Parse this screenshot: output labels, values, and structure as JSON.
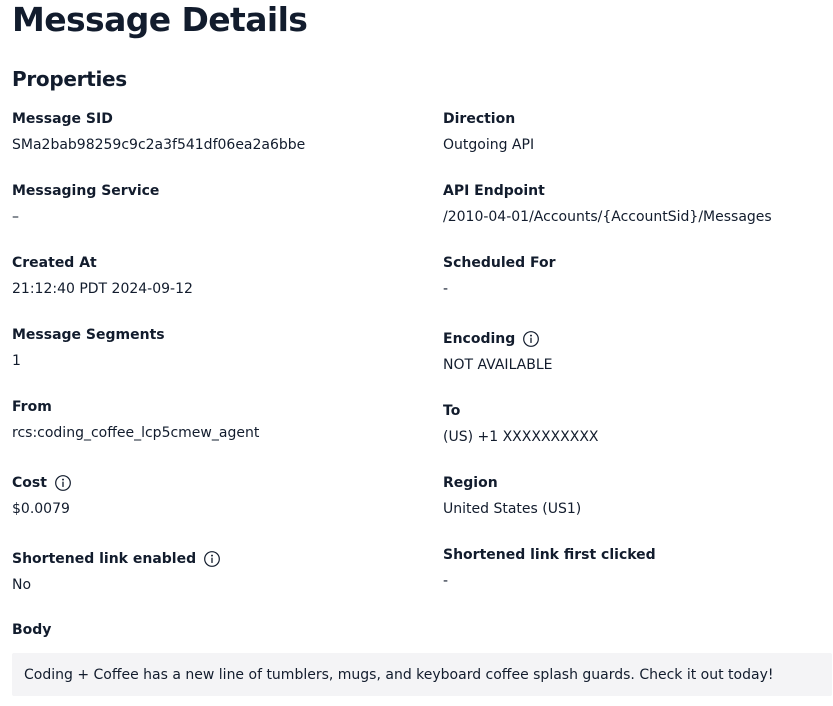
{
  "page": {
    "title": "Message Details",
    "section_title": "Properties"
  },
  "fields": {
    "message_sid": {
      "label": "Message SID",
      "value": "SMa2bab98259c9c2a3f541df06ea2a6bbe"
    },
    "direction": {
      "label": "Direction",
      "value": "Outgoing API"
    },
    "messaging_service": {
      "label": "Messaging Service",
      "value": "–"
    },
    "api_endpoint": {
      "label": "API Endpoint",
      "value": "/2010-04-01/Accounts/{AccountSid}/Messages"
    },
    "created_at": {
      "label": "Created At",
      "value": "21:12:40 PDT 2024-09-12"
    },
    "scheduled_for": {
      "label": "Scheduled For",
      "value": "-"
    },
    "message_segments": {
      "label": "Message Segments",
      "value": "1"
    },
    "encoding": {
      "label": "Encoding",
      "value": "NOT AVAILABLE",
      "icon": "info-icon"
    },
    "from": {
      "label": "From",
      "value": "rcs:coding_coffee_lcp5cmew_agent"
    },
    "to": {
      "label": "To",
      "value": "(US) +1 XXXXXXXXXX"
    },
    "cost": {
      "label": "Cost",
      "value": "$0.0079",
      "icon": "info-icon"
    },
    "region": {
      "label": "Region",
      "value": "United States (US1)"
    },
    "shortened_link_enabled": {
      "label": "Shortened link enabled",
      "value": "No",
      "icon": "info-icon"
    },
    "shortened_link_first_clicked": {
      "label": "Shortened link first clicked",
      "value": "-"
    }
  },
  "body": {
    "label": "Body",
    "text": "Coding + Coffee has a new line of tumblers, mugs, and keyboard coffee splash guards. Check it out today!"
  },
  "colors": {
    "text": "#121c2d",
    "body_background": "#f4f4f6"
  }
}
